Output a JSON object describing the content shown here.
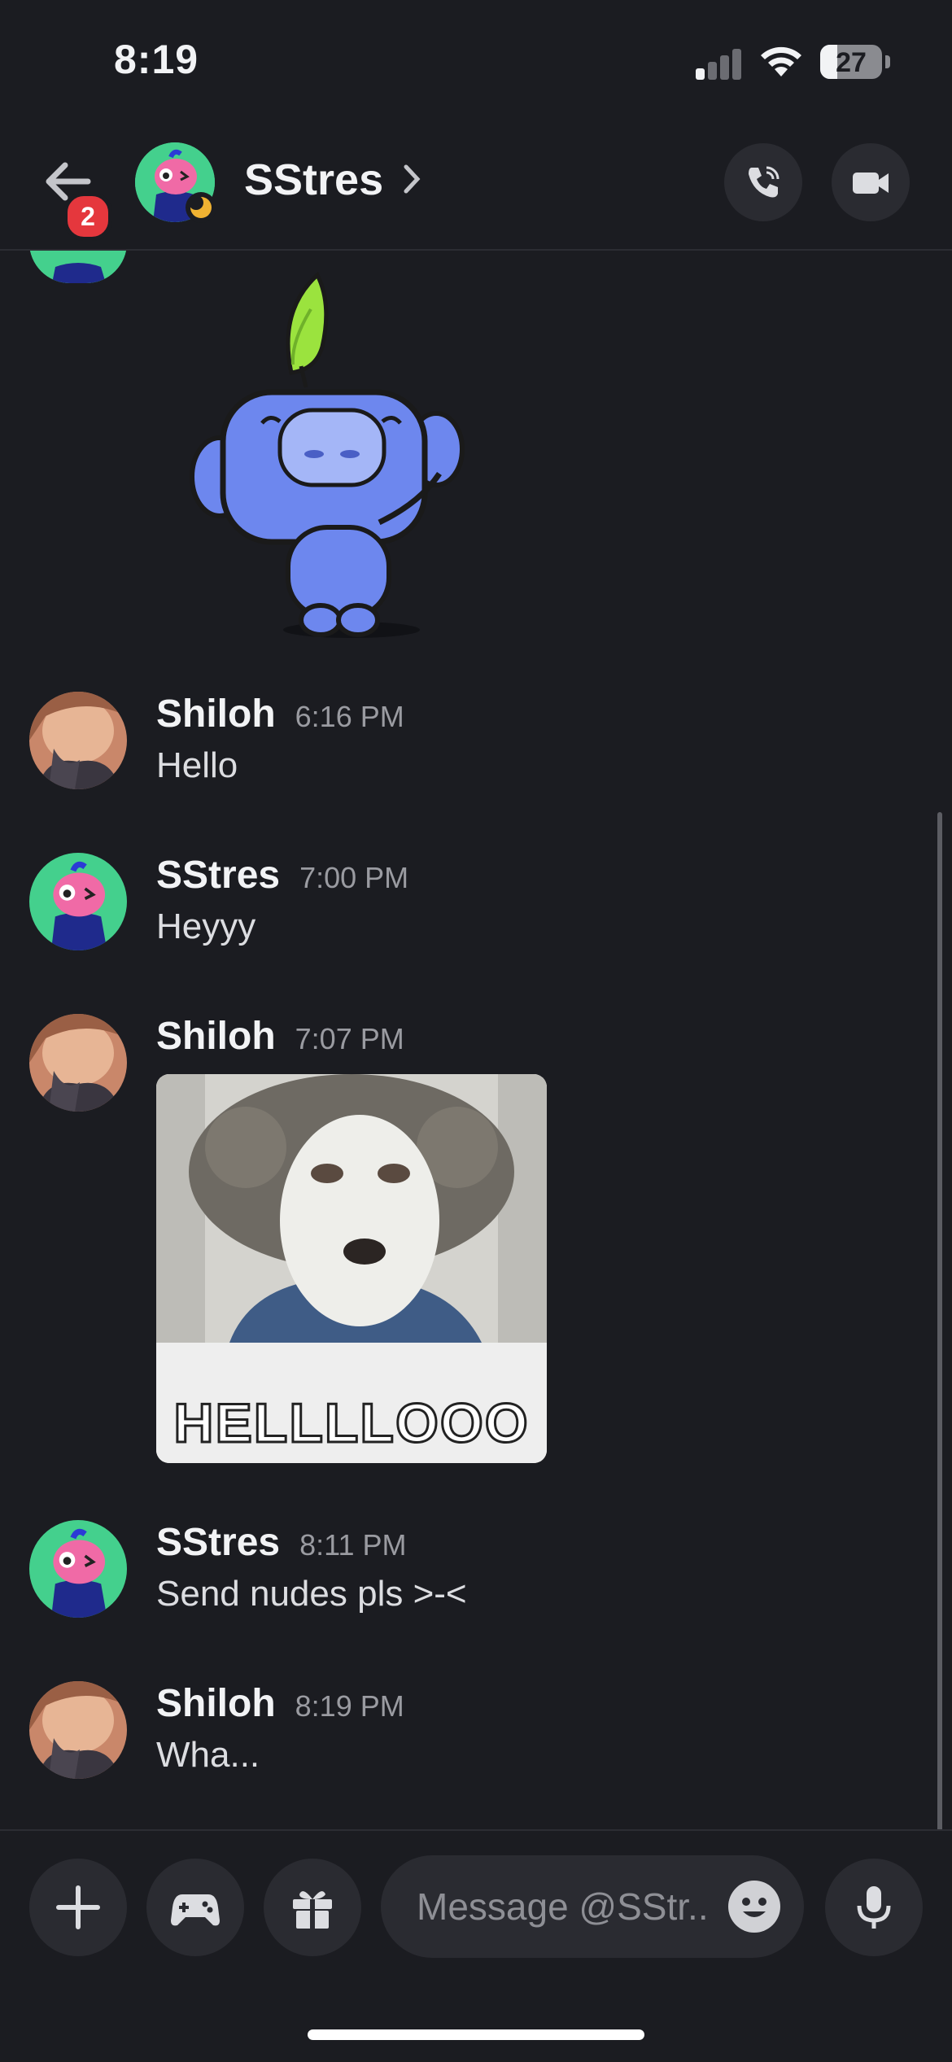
{
  "status_bar": {
    "time": "8:19",
    "battery": "27",
    "battery_level": 0.27,
    "signal_bars": 1
  },
  "header": {
    "back_badge": "2",
    "title": "SStres",
    "user_status": "idle"
  },
  "messages": [
    {
      "author": "Shiloh",
      "time": "6:16 PM",
      "text": "Hello"
    },
    {
      "author": "SStres",
      "time": "7:00 PM",
      "text": "Heyyy"
    },
    {
      "author": "Shiloh",
      "time": "7:07 PM",
      "gif_caption": "HELLLLOOO"
    },
    {
      "author": "SStres",
      "time": "8:11 PM",
      "text": "Send nudes pls >-<"
    },
    {
      "author": "Shiloh",
      "time": "8:19 PM",
      "text": "Wha..."
    }
  ],
  "composer": {
    "placeholder": "Message @SStr.."
  },
  "colors": {
    "background": "#1b1c21",
    "accent_badge": "#e5373d",
    "avatar_green": "#44d08d",
    "idle_yellow": "#f0b232",
    "sticker_blue": "#6d87ee",
    "leaf_green": "#9be33e"
  }
}
